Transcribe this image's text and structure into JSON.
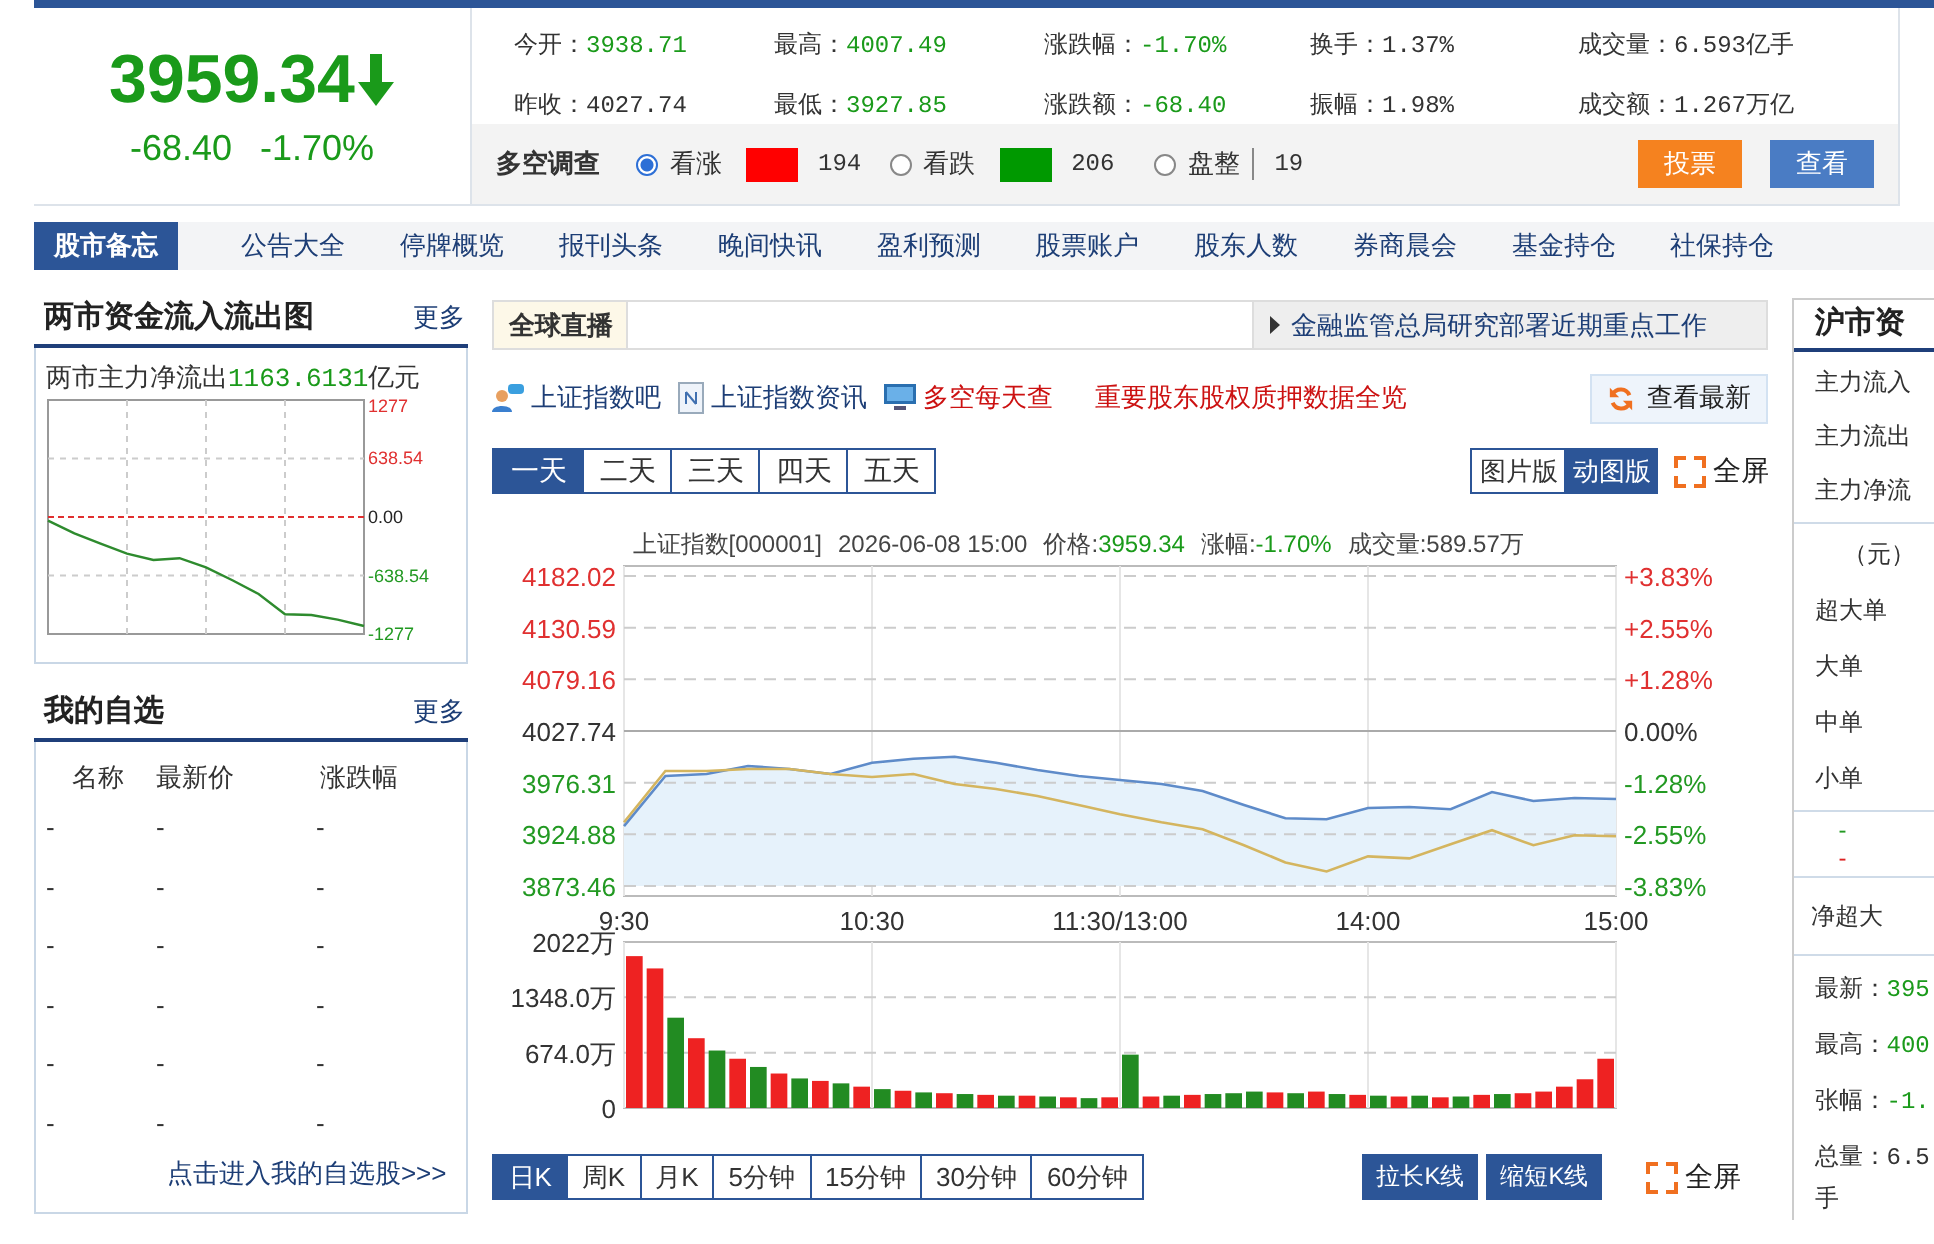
{
  "quote": {
    "price": "3959.34",
    "falling": true,
    "change": "-68.40",
    "change_pct": "-1.70%"
  },
  "stats": [
    {
      "label": "今开：",
      "value": "3938.71",
      "colored": true
    },
    {
      "label": "最高：",
      "value": "4007.49",
      "colored": true
    },
    {
      "label": "涨跌幅：",
      "value": "-1.70%",
      "colored": true
    },
    {
      "label": "换手：",
      "value": "1.37%",
      "colored": false
    },
    {
      "label": "成交量：",
      "value": "6.593亿手",
      "colored": false
    },
    {
      "label": "昨收：",
      "value": "4027.74",
      "colored": false
    },
    {
      "label": "最低：",
      "value": "3927.85",
      "colored": true
    },
    {
      "label": "涨跌额：",
      "value": "-68.40",
      "colored": true
    },
    {
      "label": "振幅：",
      "value": "1.98%",
      "colored": false
    },
    {
      "label": "成交额：",
      "value": "1.267万亿",
      "colored": false
    }
  ],
  "survey": {
    "title": "多空调查",
    "options": [
      {
        "label": "看涨",
        "selected": true,
        "color": "#ff0000",
        "count": "194"
      },
      {
        "label": "看跌",
        "selected": false,
        "color": "#009900",
        "count": "206"
      },
      {
        "label": "盘整",
        "selected": false,
        "count": "19"
      }
    ],
    "buttons": [
      {
        "label": "投票",
        "kind": "vote"
      },
      {
        "label": "查看",
        "kind": "view"
      }
    ]
  },
  "nav": {
    "title": "股市备忘",
    "links": [
      "公告大全",
      "停牌概览",
      "报刊头条",
      "晚间快讯",
      "盈利预测",
      "股票账户",
      "股东人数",
      "券商晨会",
      "基金持仓",
      "社保持仓"
    ]
  },
  "fund_flow": {
    "title": "两市资金流入流出图",
    "more": "更多",
    "caption_label": "两市主力净流出",
    "caption_value": "1163.6131",
    "caption_unit": "亿元",
    "chart_data": {
      "type": "line",
      "grid": true,
      "ref_lines": [
        {
          "axis": "y",
          "value": 0
        }
      ],
      "ylim": [
        -1277,
        1277
      ],
      "yticks": [
        1277,
        638.54,
        {
          "value": 0,
          "label": "0.00"
        },
        -638.54,
        -1277
      ],
      "series": [
        {
          "color": "#2e8b2e",
          "values": [
            -40,
            -180,
            -290,
            -400,
            -470,
            -450,
            -550,
            -690,
            -840,
            -1060,
            -1070,
            -1120,
            -1190
          ]
        }
      ]
    }
  },
  "watchlist": {
    "title": "我的自选",
    "more": "更多",
    "columns": [
      "名称",
      "最新价",
      "涨跌幅"
    ],
    "rows": [
      [
        "-",
        "-",
        "-"
      ],
      [
        "-",
        "-",
        "-"
      ],
      [
        "-",
        "-",
        "-"
      ],
      [
        "-",
        "-",
        "-"
      ],
      [
        "-",
        "-",
        "-"
      ],
      [
        "-",
        "-",
        "-"
      ]
    ],
    "link": "点击进入我的自选股>>>"
  },
  "ticker": {
    "label": "全球直播",
    "headline": "金融监管总局研究部署近期重点工作"
  },
  "quick_links": [
    {
      "label": "上证指数吧",
      "kind": "forum",
      "highlight": false
    },
    {
      "label": "上证指数资讯",
      "kind": "news",
      "highlight": false
    },
    {
      "label": "多空每天查",
      "kind": "monitor",
      "highlight": true
    },
    {
      "label": "重要股东股权质押数据全览",
      "kind": "plain",
      "highlight": true
    }
  ],
  "refresh_button": "查看最新",
  "day_tabs": [
    {
      "label": "一天",
      "selected": true
    },
    {
      "label": "二天",
      "selected": false
    },
    {
      "label": "三天",
      "selected": false
    },
    {
      "label": "四天",
      "selected": false
    },
    {
      "label": "五天",
      "selected": false
    }
  ],
  "view_toggle": [
    {
      "label": "图片版",
      "selected": false
    },
    {
      "label": "动图版",
      "selected": true
    }
  ],
  "fullscreen": "全屏",
  "intraday": {
    "name": "上证指数[000001]",
    "time": "2026-06-08 15:00",
    "price_label": "价格:",
    "price": "3959.34",
    "change_label": "涨幅:",
    "change": "-1.70%",
    "volume_label": "成交量:",
    "volume": "589.57万",
    "pct_ticks": [
      "+3.83%",
      "+2.55%",
      "+1.28%",
      "0.00%",
      "-1.28%",
      "-2.55%",
      "-3.83%"
    ],
    "chart_data": {
      "type": "line",
      "grid": true,
      "ref_lines": [
        {
          "axis": "y",
          "value": 4027.74
        }
      ],
      "categories": [
        "9:30",
        null,
        null,
        null,
        null,
        null,
        "10:30",
        null,
        null,
        null,
        null,
        null,
        "11:30/13:00",
        null,
        null,
        null,
        null,
        null,
        "14:00",
        null,
        null,
        null,
        null,
        null,
        "15:00"
      ],
      "ylim": [
        3873.46,
        4182.02
      ],
      "yticks": [
        4182.02,
        4130.59,
        4079.16,
        4027.74,
        3976.31,
        3924.88,
        3873.46
      ],
      "series": [
        {
          "color": "#5e8bc9",
          "values": [
            3933,
            3983,
            3985,
            3993,
            3990,
            3985,
            3996,
            4000,
            4002,
            3996,
            3989,
            3983,
            3979,
            3975,
            3968,
            3954,
            3941,
            3940,
            3951,
            3952,
            3950,
            3967,
            3958,
            3961,
            3960
          ]
        },
        {
          "color": "#d4b55f",
          "values": [
            3937,
            3988,
            3988,
            3990,
            3990,
            3985,
            3982,
            3985,
            3975,
            3970,
            3963,
            3954,
            3945,
            3937,
            3930,
            3914,
            3897,
            3888,
            3903,
            3901,
            3915,
            3929,
            3914,
            3924,
            3923
          ]
        }
      ]
    }
  },
  "volume": {
    "chart_data": {
      "type": "bar",
      "grid": true,
      "ylim": [
        0,
        2022
      ],
      "yticks": [
        {
          "value": 0,
          "label": "0"
        },
        {
          "value": 674,
          "label": "674.0万"
        },
        {
          "value": 1348,
          "label": "1348.0万"
        },
        {
          "value": 2022,
          "label": "2022万"
        }
      ],
      "series": [
        {
          "color": "#ee2222",
          "values": [
            1850,
            1700,
            null,
            850,
            null,
            600,
            null,
            420,
            null,
            330,
            null,
            260,
            null,
            210,
            null,
            180,
            null,
            160,
            null,
            150,
            null,
            130,
            null,
            130,
            null,
            140,
            null,
            160,
            null,
            null,
            null,
            190,
            null,
            200,
            null,
            160,
            null,
            140,
            null,
            130,
            null,
            160,
            null,
            180,
            200,
            260,
            350,
            600
          ]
        },
        {
          "color": "#228b22",
          "values": [
            null,
            null,
            1100,
            null,
            700,
            null,
            500,
            null,
            360,
            null,
            300,
            null,
            230,
            null,
            190,
            null,
            170,
            null,
            150,
            null,
            140,
            null,
            120,
            null,
            650,
            null,
            150,
            null,
            170,
            180,
            200,
            null,
            180,
            null,
            170,
            null,
            150,
            null,
            150,
            null,
            140,
            null,
            170,
            null,
            null,
            null,
            null,
            null
          ]
        }
      ]
    }
  },
  "kline_tabs": [
    {
      "label": "日K",
      "selected": true
    },
    {
      "label": "周K",
      "selected": false
    },
    {
      "label": "月K",
      "selected": false
    },
    {
      "label": "5分钟",
      "selected": false
    },
    {
      "label": "15分钟",
      "selected": false
    },
    {
      "label": "30分钟",
      "selected": false
    },
    {
      "label": "60分钟",
      "selected": false
    }
  ],
  "kline_buttons": [
    "拉长K线",
    "缩短K线"
  ],
  "kline_fullscreen": "全屏",
  "right_panel": {
    "title": "沪市资",
    "flow_rows": [
      "主力流入",
      "主力流出",
      "主力净流"
    ],
    "unit": "（元）",
    "size_rows": [
      "超大单",
      "大单",
      "中单",
      "小单"
    ],
    "dashes": [
      {
        "text": "-",
        "color": "#229922"
      },
      {
        "text": "-",
        "color": "#dd2222"
      }
    ],
    "column_label": "净超大",
    "quote_rows": [
      {
        "label": "最新：",
        "value": "395",
        "colored": true
      },
      {
        "label": "最高：",
        "value": "400",
        "colored": true
      },
      {
        "label": "张幅：",
        "value": "-1.",
        "colored": true
      },
      {
        "label": "总量：",
        "value": "6.5",
        "colored": false
      }
    ],
    "trailing": "手"
  }
}
